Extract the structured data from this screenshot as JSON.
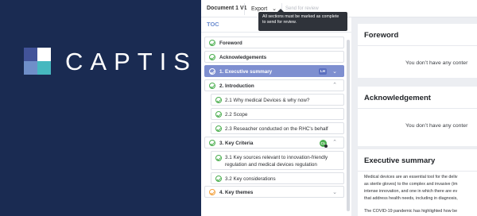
{
  "brand": {
    "name": "CAPTIS"
  },
  "topbar": {
    "document_label": "Document  1 V1",
    "export_label": "Export",
    "send_label": "Send for review",
    "tooltip": "All sections must be marked as complete to send for review."
  },
  "toc": {
    "title": "TOC",
    "items": [
      {
        "label": "Foreword"
      },
      {
        "label": "Acknowledgements"
      },
      {
        "label": "1. Executive summary",
        "avatar": "LH"
      },
      {
        "label": "2. Introduction"
      },
      {
        "label": "2.1 Why medical Devices & why now?"
      },
      {
        "label": "2.2 Scope"
      },
      {
        "label": "2.3 Reseacher conducted on the RHC's behalf"
      },
      {
        "label": "3. Key Criteria",
        "avatar": "CL"
      },
      {
        "label_line1": "3.1 Key sources relevant to innovation-friendly",
        "label_line2": "regulation and medical devices regulation"
      },
      {
        "label": "3.2 Key considerations"
      },
      {
        "label": "4. Key themes"
      }
    ]
  },
  "content": {
    "foreword": {
      "title": "Foreword",
      "empty": "You don’t have any conter"
    },
    "acknowledgement": {
      "title": "Acknowledgement",
      "empty": "You don’t have any conter"
    },
    "executive_summary": {
      "title": "Executive summary",
      "lines": [
        "Medical devices are an essential tool for the deliv",
        "as sterile gloves) to the complex and invasive (im",
        "intense innovation, and one in which there are ev",
        "that address health needs, including in diagnosis,",
        "",
        "The COVID-19 pandemic has highlighted how be"
      ]
    }
  },
  "colors": {
    "brand_bg": "#1a2b52",
    "active_item": "#7e8fd0",
    "check_green": "#4caf50",
    "warn_orange": "#f2a03d"
  }
}
